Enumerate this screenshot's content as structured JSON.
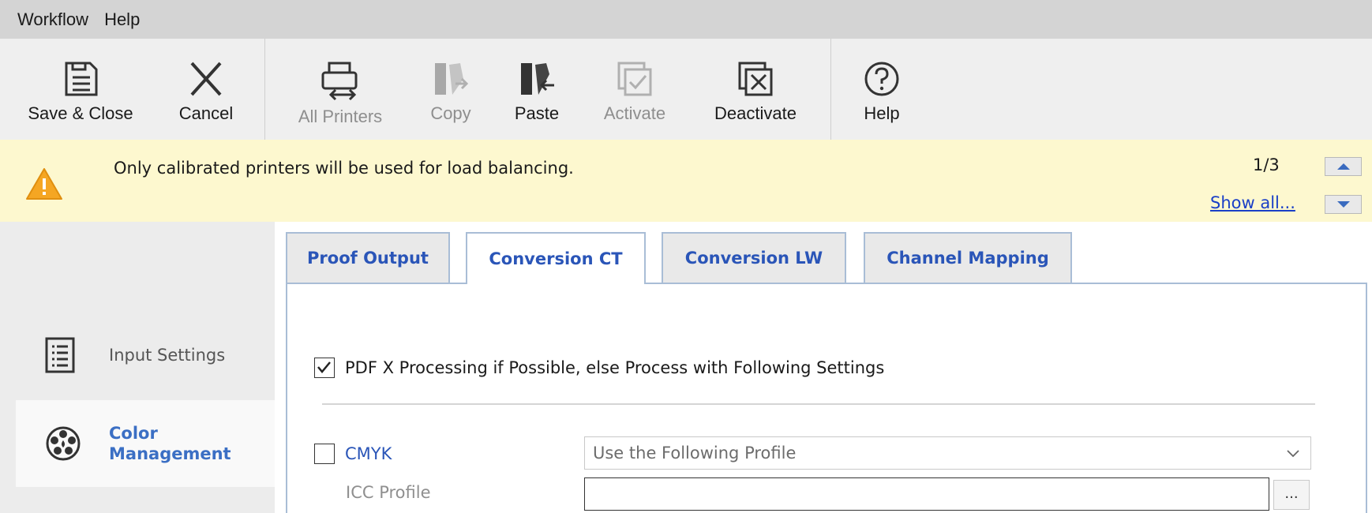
{
  "menu": {
    "items": [
      "Workflow",
      "Help"
    ]
  },
  "toolbar": {
    "buttons": [
      {
        "label": "Save & Close",
        "icon": "save-icon",
        "enabled": true
      },
      {
        "label": "Cancel",
        "icon": "close-icon",
        "enabled": true
      },
      {
        "label": "All Printers",
        "icon": "printers-icon",
        "enabled": false
      },
      {
        "label": "Copy",
        "icon": "copy-icon",
        "enabled": false
      },
      {
        "label": "Paste",
        "icon": "paste-icon",
        "enabled": true
      },
      {
        "label": "Activate",
        "icon": "activate-icon",
        "enabled": false
      },
      {
        "label": "Deactivate",
        "icon": "deactivate-icon",
        "enabled": true
      },
      {
        "label": "Help",
        "icon": "help-icon",
        "enabled": true
      }
    ]
  },
  "notification": {
    "icon": "warning-icon",
    "message": "Only calibrated printers will be used for load balancing.",
    "counter": "1/3",
    "link": "Show all..."
  },
  "nav": {
    "items": [
      {
        "label": "Input Settings",
        "icon": "list-icon",
        "active": false
      },
      {
        "label": "Color Management",
        "label_line1": "Color",
        "label_line2": "Management",
        "icon": "color-management-icon",
        "active": true
      }
    ]
  },
  "tabs": [
    {
      "label": "Proof Output",
      "active": false
    },
    {
      "label": "Conversion CT",
      "active": true
    },
    {
      "label": "Conversion LW",
      "active": false
    },
    {
      "label": "Channel Mapping",
      "active": false
    }
  ],
  "form": {
    "pdfx": {
      "label": "PDF X Processing if Possible, else Process with Following Settings",
      "checked": true
    },
    "cmyk": {
      "label": "CMYK",
      "checked": false
    },
    "profile_select": {
      "value": "Use the Following Profile"
    },
    "icc_profile": {
      "label": "ICC Profile",
      "value": "",
      "browse_label": "..."
    }
  },
  "colors": {
    "accent": "#2a55b8",
    "tab_border": "#a9bdd6",
    "notice_bg": "#fdf8cf",
    "warning": "#f5a623"
  }
}
